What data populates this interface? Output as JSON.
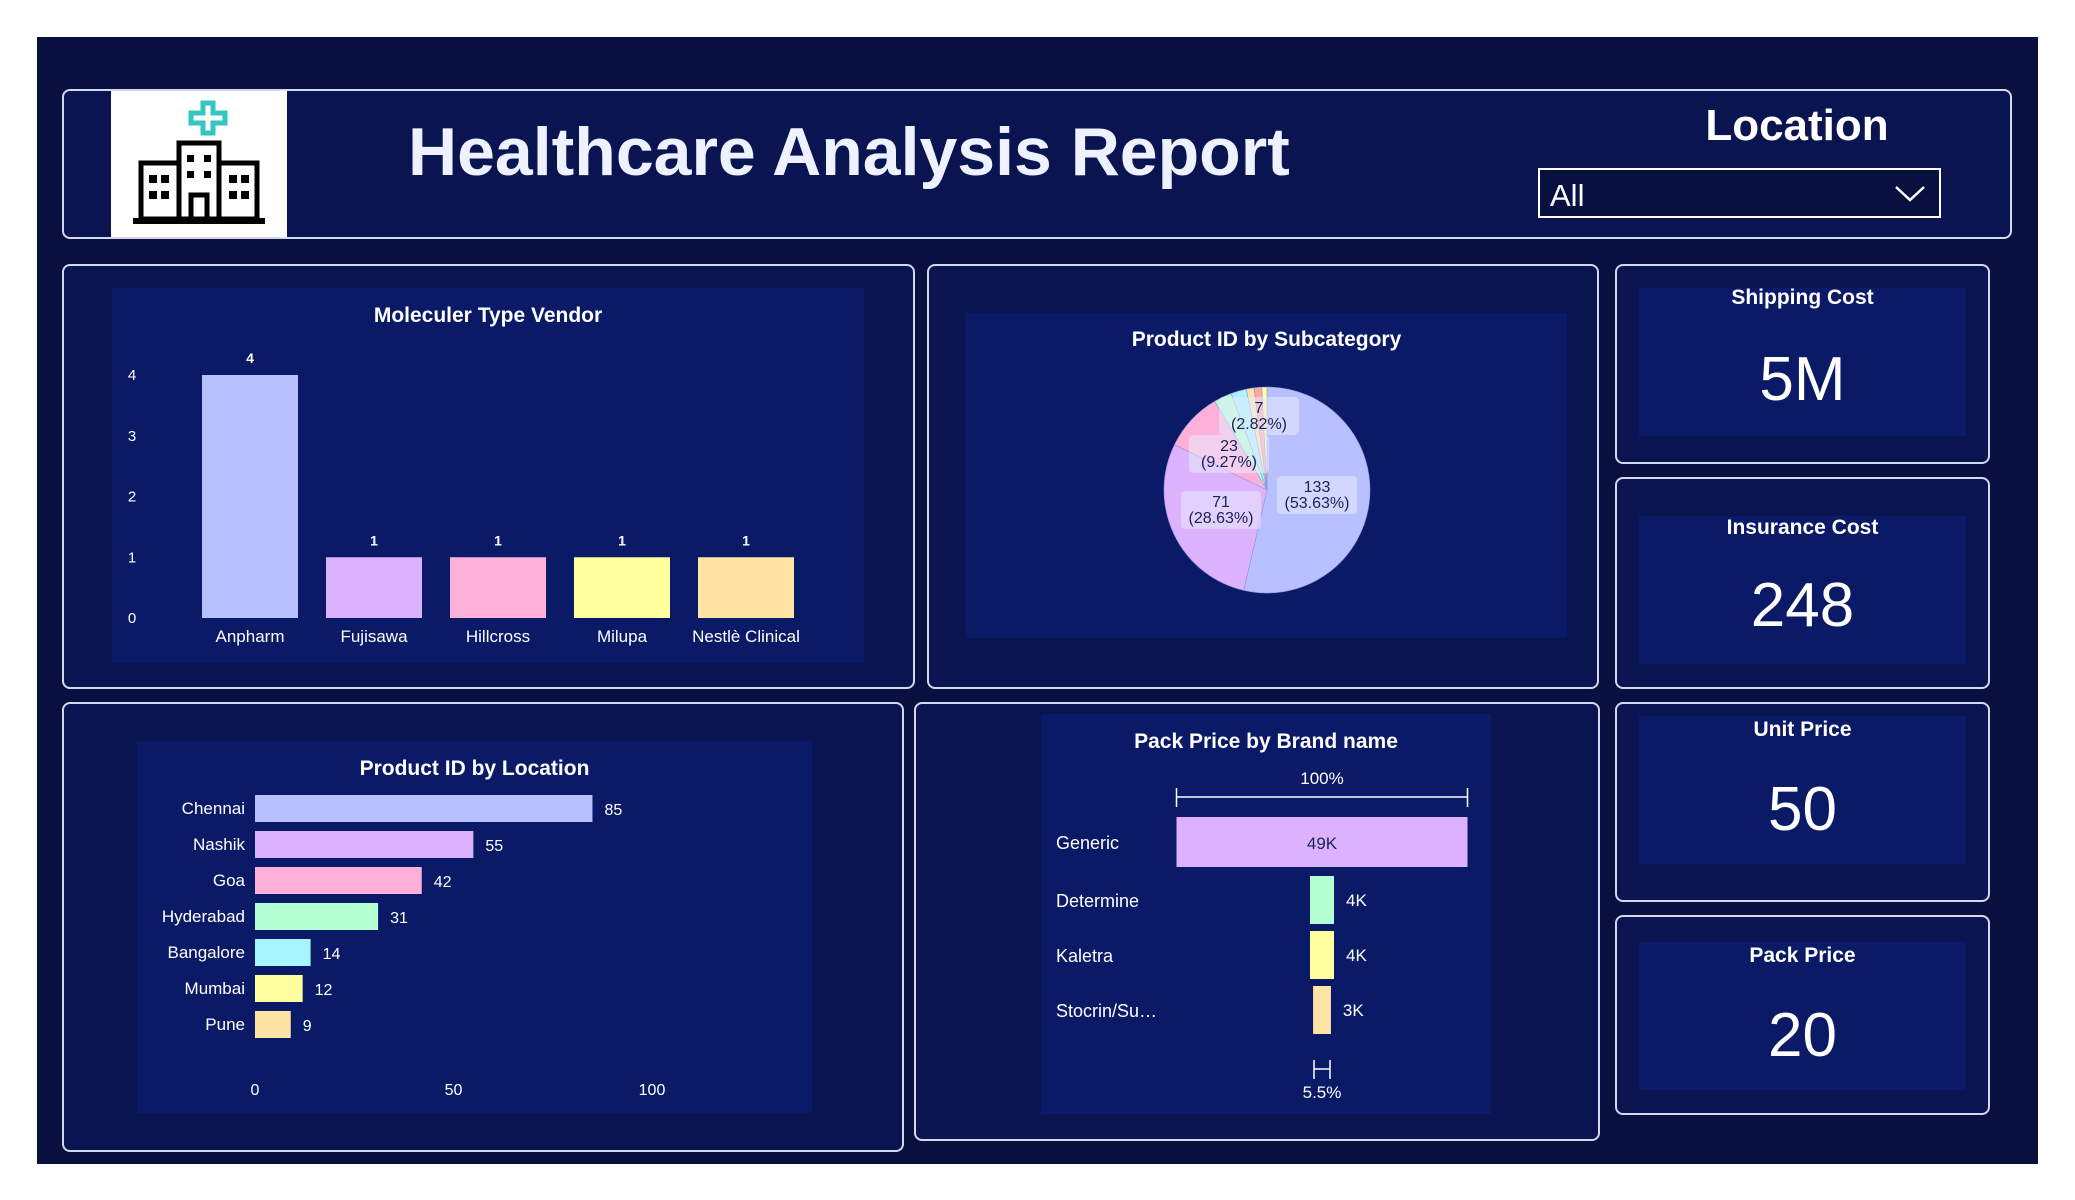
{
  "header": {
    "title": "Healthcare Analysis Report",
    "logo_icon": "hospital-icon",
    "location_label": "Location",
    "location_value": "All"
  },
  "charts": {
    "vendor": {
      "title": "Moleculer Type Vendor"
    },
    "subcategory": {
      "title": "Product ID by Subcategory"
    },
    "location": {
      "title": "Product ID by Location"
    },
    "brand": {
      "title": "Pack Price by Brand name"
    }
  },
  "kpis": [
    {
      "title": "Shipping Cost",
      "value": "5M"
    },
    {
      "title": "Insurance Cost",
      "value": "248"
    },
    {
      "title": "Unit Price",
      "value": "50"
    },
    {
      "title": "Pack Price",
      "value": "20"
    }
  ],
  "colors": {
    "background": "#07103e",
    "panel": "#091450",
    "pastel": [
      "#b8c0ff",
      "#dcb2ff",
      "#ffb0d9",
      "#ffffa0",
      "#ffe4a6",
      "#b4ffd4",
      "#a6f4ff"
    ]
  },
  "chart_data": [
    {
      "type": "bar",
      "title": "Moleculer Type Vendor",
      "categories": [
        "Anpharm",
        "Fujisawa",
        "Hillcross",
        "Milupa",
        "Nestlè Clinical"
      ],
      "values": [
        4,
        1,
        1,
        1,
        1
      ],
      "data_labels": [
        "4",
        "1",
        "1",
        "1",
        "1"
      ],
      "yticks": [
        "0",
        "1",
        "2",
        "3",
        "4"
      ],
      "ylim": [
        0,
        4
      ],
      "colors": [
        "#b8c0ff",
        "#dcb2ff",
        "#ffb0d9",
        "#ffffa0",
        "#ffe4a6"
      ],
      "grid": false
    },
    {
      "type": "pie",
      "title": "Product ID by Subcategory",
      "slices": [
        {
          "value": 133,
          "label": "133\n(53.63%)",
          "color": "#b8c0ff"
        },
        {
          "value": 71,
          "label": "71\n(28.63%)",
          "color": "#dcb2ff"
        },
        {
          "value": 23,
          "label": "23\n(9.27%)",
          "color": "#ffb0d9"
        },
        {
          "value": 7,
          "label": "7\n(2.82%)",
          "color": "#b4ffd4"
        },
        {
          "value": 6,
          "label": "",
          "color": "#a6f4ff"
        },
        {
          "value": 3,
          "label": "",
          "color": "#ffe4a6"
        },
        {
          "value": 3,
          "label": "",
          "color": "#ffa6a6"
        },
        {
          "value": 2,
          "label": "",
          "color": "#ffffa0"
        }
      ]
    },
    {
      "type": "bar",
      "orientation": "horizontal",
      "title": "Product ID by Location",
      "categories": [
        "Chennai",
        "Nashik",
        "Goa",
        "Hyderabad",
        "Bangalore",
        "Mumbai",
        "Pune"
      ],
      "values": [
        85,
        55,
        42,
        31,
        14,
        12,
        9
      ],
      "data_labels": [
        "85",
        "55",
        "42",
        "31",
        "14",
        "12",
        "9"
      ],
      "xticks": [
        "0",
        "50",
        "100"
      ],
      "xlim": [
        0,
        100
      ],
      "colors": [
        "#b8c0ff",
        "#dcb2ff",
        "#ffb0d9",
        "#b4ffd4",
        "#a6f4ff",
        "#ffffa0",
        "#ffe4a6"
      ],
      "grid": false
    },
    {
      "type": "bar",
      "orientation": "horizontal",
      "subtype": "funnel",
      "title": "Pack Price by Brand name",
      "categories": [
        "Generic",
        "Determine",
        "Kaletra",
        "Stocrin/Su…"
      ],
      "values": [
        49000,
        4000,
        4000,
        3000
      ],
      "data_labels": [
        "49K",
        "4K",
        "4K",
        "3K"
      ],
      "top_percent_label": "100%",
      "bottom_percent_label": "5.5%",
      "colors": [
        "#dcb2ff",
        "#b4ffd4",
        "#ffffa0",
        "#ffe4a6"
      ]
    }
  ]
}
